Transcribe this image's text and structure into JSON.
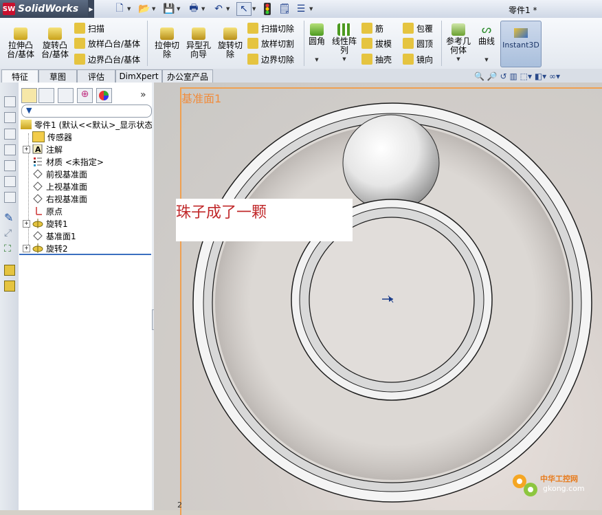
{
  "app": {
    "brand": "SolidWorks",
    "logo_mark": "SW",
    "document_title": "零件1 *"
  },
  "quick_access": [
    {
      "icon": "new-file-icon"
    },
    {
      "icon": "open-folder-icon"
    },
    {
      "icon": "save-icon"
    },
    {
      "icon": "print-icon"
    },
    {
      "icon": "undo-icon"
    },
    {
      "icon": "select-cursor-icon"
    },
    {
      "icon": "rebuild-traffic-light-icon"
    },
    {
      "icon": "file-properties-icon"
    },
    {
      "icon": "options-icon"
    }
  ],
  "ribbon": {
    "extrude_boss": "拉伸凸\n台/基体",
    "revolve_boss": "旋转凸\n台/基体",
    "sweep": "扫描",
    "loft_boss": "放样凸台/基体",
    "boundary_boss": "边界凸台/基体",
    "extrude_cut": "拉伸切\n除",
    "hole_wizard": "异型孔\n向导",
    "revolve_cut": "旋转切\n除",
    "swept_cut": "扫描切除",
    "lofted_cut": "放样切割",
    "boundary_cut": "边界切除",
    "fillet": "圆角",
    "linear_pattern": "线性阵\n列",
    "rib": "筋",
    "draft": "拔模",
    "shell": "抽壳",
    "wrap": "包覆",
    "dome": "圆顶",
    "mirror": "镜向",
    "ref_geometry": "参考几\n何体",
    "curves": "曲线",
    "instant3d": "Instant3D"
  },
  "tabs": [
    "特征",
    "草图",
    "评估",
    "DimXpert",
    "办公室产品"
  ],
  "tree": {
    "root": "零件1   (默认<<默认>_显示状态",
    "items": [
      {
        "label": "传感器",
        "icon": "sensor-icon",
        "expandable": false
      },
      {
        "label": "注解",
        "icon": "annotation-icon",
        "expandable": true
      },
      {
        "label": "材质 <未指定>",
        "icon": "material-icon",
        "expandable": false
      },
      {
        "label": "前视基准面",
        "icon": "plane-icon",
        "expandable": false
      },
      {
        "label": "上视基准面",
        "icon": "plane-icon",
        "expandable": false
      },
      {
        "label": "右视基准面",
        "icon": "plane-icon",
        "expandable": false
      },
      {
        "label": "原点",
        "icon": "origin-icon",
        "expandable": false
      },
      {
        "label": "旋转1",
        "icon": "revolve-icon",
        "expandable": true
      },
      {
        "label": "基准面1",
        "icon": "plane-icon",
        "expandable": false
      },
      {
        "label": "旋转2",
        "icon": "revolve-icon",
        "expandable": true
      }
    ]
  },
  "viewport": {
    "plane_label": "基准面1",
    "annotation": "珠子成了一颗",
    "corner_digit": "2"
  },
  "watermark": {
    "cn": "中华工控网",
    "url": "gkong.com"
  },
  "colors": {
    "accent_orange": "#f08c3c",
    "annotation_red": "#c0282a",
    "brand_red": "#c8102e"
  }
}
